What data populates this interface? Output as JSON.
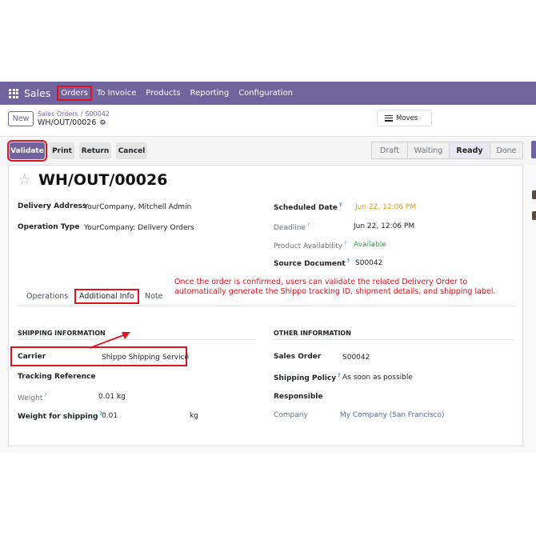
{
  "navbar": {
    "app": "Sales",
    "items": [
      "Orders",
      "To Invoice",
      "Products",
      "Reporting",
      "Configuration"
    ]
  },
  "control": {
    "new_label": "New",
    "breadcrumb": [
      "Sales Orders",
      "S00042"
    ],
    "breadcrumb_sep": "/",
    "record": "WH/OUT/00026",
    "moves_label": "Moves"
  },
  "actions": {
    "buttons": [
      "Validate",
      "Print",
      "Return",
      "Cancel"
    ],
    "stages": [
      "Draft",
      "Waiting",
      "Ready",
      "Done"
    ],
    "active_stage": "Ready"
  },
  "form": {
    "title": "WH/OUT/00026",
    "delivery_address_label": "Delivery Address",
    "delivery_address": "YourCompany, Mitchell Admin",
    "operation_type_label": "Operation Type",
    "operation_type": "YourCompany: Delivery Orders",
    "scheduled_date_label": "Scheduled Date",
    "scheduled_date": "Jun 22, 12:06 PM",
    "deadline_label": "Deadline",
    "deadline": "Jun 22, 12:06 PM",
    "product_availability_label": "Product Availability",
    "product_availability": "Available",
    "source_document_label": "Source Document",
    "source_document": "S00042",
    "help_mark": "?"
  },
  "tabs": [
    "Operations",
    "Additional Info",
    "Note"
  ],
  "annotation": "Once the order is confirmed, users can validate the related Delivery Order to automatically generate the Shippo tracking ID, shipment details, and shipping label.",
  "shipping": {
    "heading": "SHIPPING INFORMATION",
    "carrier_label": "Carrier",
    "carrier": "Shippo Shipping Service",
    "tracking_label": "Tracking Reference",
    "weight_label": "Weight",
    "weight": "0.01 kg",
    "weight_shipping_label": "Weight for shipping",
    "weight_shipping": "0.01",
    "weight_unit": "kg"
  },
  "other": {
    "heading": "OTHER INFORMATION",
    "sales_order_label": "Sales Order",
    "sales_order": "S00042",
    "shipping_policy_label": "Shipping Policy",
    "shipping_policy": "As soon as possible",
    "responsible_label": "Responsible",
    "company_label": "Company",
    "company": "My Company (San Francisco)"
  },
  "colors": {
    "brand": "#71639e",
    "highlight": "#e0121d",
    "warning": "#e39e0a",
    "success": "#28a745"
  }
}
